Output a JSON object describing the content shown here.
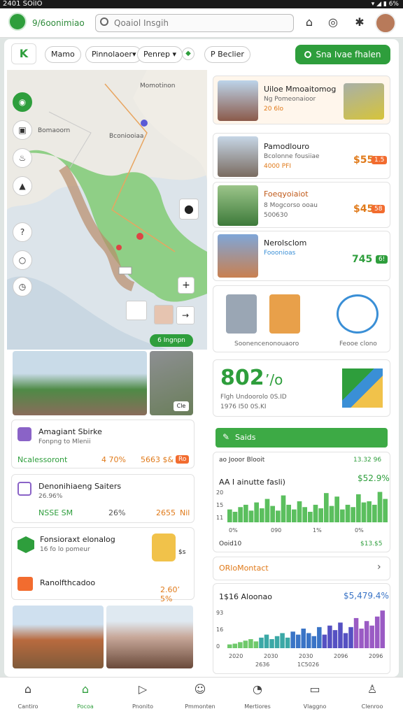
{
  "status": {
    "time": "2401 SOiIO",
    "icons": "▾ ◢ ▮ 6%"
  },
  "header": {
    "brand": "9/6oonimiao",
    "search_placeholder": "Qoaiol Insgih"
  },
  "toolbar": {
    "back": "K",
    "pills": [
      "Mamo",
      "Pinnolaoer▾",
      "Penrep ▾"
    ],
    "filter": "P Beclier",
    "cta": "Sna Ivae fhalen"
  },
  "map": {
    "labels": [
      "Bomaoorn",
      "Bconiooiaa",
      "Momotinon"
    ],
    "badge": "6 Ingnpn",
    "plus": "+",
    "arrow": "→"
  },
  "left_cards": [
    {
      "title": "Amagiant Sbirke",
      "sub": "Fonpng to Mlenii",
      "tag": "Ncalessoront",
      "pct": "4 70%",
      "price": "5663 $&",
      "badge": "Ro"
    },
    {
      "title": "Denonihiaeng Saiters",
      "sub": "26.96%",
      "tag": "NSSE SM",
      "pct": "26%",
      "price": "2655",
      "badge": "Nil"
    },
    {
      "title": "Fonsioraxt elonalog",
      "sub": "16 fo lo pomeur",
      "tag": "",
      "pct": "",
      "price": "$s",
      "badge": ""
    },
    {
      "title": "Ranolfthcadoo",
      "sub": "",
      "tag": "",
      "pct": "",
      "price": "2.60’ 5%",
      "badge": ""
    }
  ],
  "photo_tag": "Cle",
  "right_list": [
    {
      "title": "Uiloe Mmoaitomog",
      "sub": "Ng Pomeonaioor",
      "meta": "20 6lo",
      "price": "",
      "badge": ""
    },
    {
      "title": "Pamodlouro",
      "sub": "Bcolonne fousiiae",
      "meta": "4000 PFI",
      "price": "$55",
      "badge": "1.5"
    },
    {
      "title": "Foeqyoiaiot",
      "sub": "8 Mogcorso ooau",
      "meta": "500630",
      "price": "$45",
      "badge": "58"
    },
    {
      "title": "Nerolsclom",
      "sub": "Fooonioas",
      "meta": "",
      "price": "745",
      "badge": "6!"
    }
  ],
  "illustrations": {
    "left_caption": "Soonencenonouaoro",
    "right_caption": "Feooe clono"
  },
  "stat": {
    "value": "802",
    "suffix": "’/o",
    "line1": "Flgh Undoorolo 0S.ID",
    "line2": "1976 I50 0S.KI"
  },
  "green_header": {
    "label": "Saids"
  },
  "bar1": {
    "left": "ao Jooor Blooit",
    "right": "13.32 96",
    "title": "AA I ainutte fasli)",
    "value": "$52.9%",
    "bottom_left": "Ooid10",
    "bottom_right": "$13.$5",
    "yticks": [
      "20",
      "15",
      "11"
    ],
    "xticks": [
      "0%",
      "090",
      "1%",
      "0%"
    ]
  },
  "link_row": {
    "label": "ORloMontact"
  },
  "bar2": {
    "title": "1$16 Aloonao",
    "value": "$5,479.4%",
    "yticks": [
      "93",
      "16",
      "0"
    ],
    "xticks": [
      "2020",
      "2030",
      "2030",
      "2096",
      "2096"
    ],
    "xticks2": [
      "2636",
      "1C5026"
    ]
  },
  "chart_data": [
    {
      "type": "bar",
      "title": "AA I ainutte fasli)",
      "ylabel": "",
      "xlabel": "",
      "values": [
        22,
        18,
        26,
        30,
        20,
        34,
        24,
        40,
        28,
        20,
        46,
        30,
        22,
        36,
        26,
        18,
        30,
        24,
        50,
        28,
        44,
        22,
        30,
        26,
        48,
        34,
        36,
        30,
        52,
        40
      ],
      "color": "#5bbf5e"
    },
    {
      "type": "bar",
      "title": "1$16 Aloonao",
      "series": [
        {
          "values": [
            5,
            6,
            8,
            10,
            12,
            9,
            14,
            18,
            12,
            16,
            20,
            14,
            22,
            18,
            26,
            20,
            16,
            28,
            18,
            30,
            24,
            34,
            20,
            28,
            40,
            26,
            36,
            30,
            42,
            50
          ]
        }
      ],
      "colors": [
        "#6fc96b",
        "#3ba8a6",
        "#3a74c6",
        "#5550c2",
        "#9a5bc4"
      ]
    }
  ],
  "nav": [
    "Cantiro",
    "Pocoa",
    "Pnonito",
    "Pmmonten",
    "Mertiores",
    "Vlaggno",
    "Clenroo"
  ]
}
